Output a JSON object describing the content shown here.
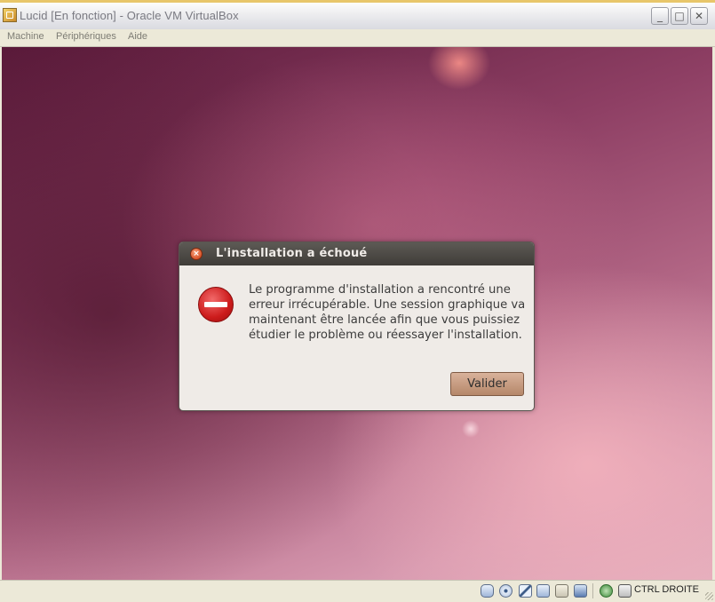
{
  "window": {
    "title": "Lucid [En fonction] - Oracle VM VirtualBox",
    "min_glyph": "_",
    "max_glyph": "□",
    "close_glyph": "✕"
  },
  "menu": {
    "items": [
      "Machine",
      "Périphériques",
      "Aide"
    ]
  },
  "dialog": {
    "title": "L'installation a échoué",
    "message": "Le programme d'installation a rencontré une\nerreur irrécupérable. Une session graphique va\nmaintenant être lancée afin que vous puissiez\nétudier le problème ou réessayer l'installation.",
    "ok_label": "Valider",
    "close_glyph": "×"
  },
  "statusbar": {
    "host_key": "CTRL DROITE",
    "icons": [
      "hard-disk-icon",
      "cd-icon",
      "usb-icon",
      "network-icon",
      "shared-folder-icon",
      "remote-display-icon",
      "mouse-integration-icon",
      "keyboard-capture-icon"
    ]
  },
  "colors": {
    "dialog_title_bg": "#4e4b47",
    "dialog_bg": "#efebe7",
    "button_bg": "#c69c82",
    "error_red": "#cc1b1b"
  }
}
